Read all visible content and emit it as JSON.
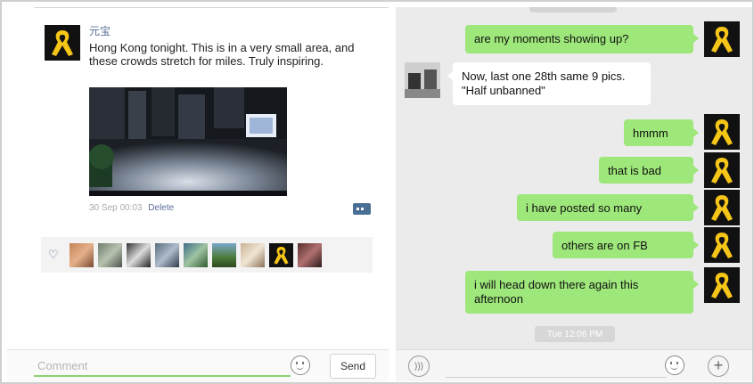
{
  "moments": {
    "author": "元宝",
    "post_text": "Hong Kong tonight. This is in a very small area, and these crowds stretch for miles. Truly inspiring.",
    "time": "30 Sep  00:03",
    "delete_label": "Delete",
    "comment_placeholder": "Comment",
    "send_label": "Send",
    "like_count_avatars": 9
  },
  "chat": {
    "messages": [
      {
        "from": "me",
        "text": "are my moments showing up?"
      },
      {
        "from": "friend",
        "text": "Now, last one 28th same 9 pics. \"Half unbanned\""
      },
      {
        "from": "me",
        "text": "hmmm"
      },
      {
        "from": "me",
        "text": "that is bad"
      },
      {
        "from": "me",
        "text": "i have posted so many"
      },
      {
        "from": "me",
        "text": "others are on FB"
      },
      {
        "from": "me",
        "text": "i will head down there again this afternoon"
      }
    ],
    "timestamp": "Tue 12:06 PM"
  },
  "icons": {
    "yellow_ribbon": "yellow-ribbon-icon",
    "heart": "heart-icon",
    "emoji": "emoji-icon",
    "voice": "voice-icon",
    "plus": "plus-icon",
    "comment": "comment-icon"
  },
  "colors": {
    "bubble_green": "#9ee77a",
    "link_blue": "#5b6f97",
    "ribbon_yellow": "#f5c518",
    "chat_bg": "#ebebeb"
  }
}
